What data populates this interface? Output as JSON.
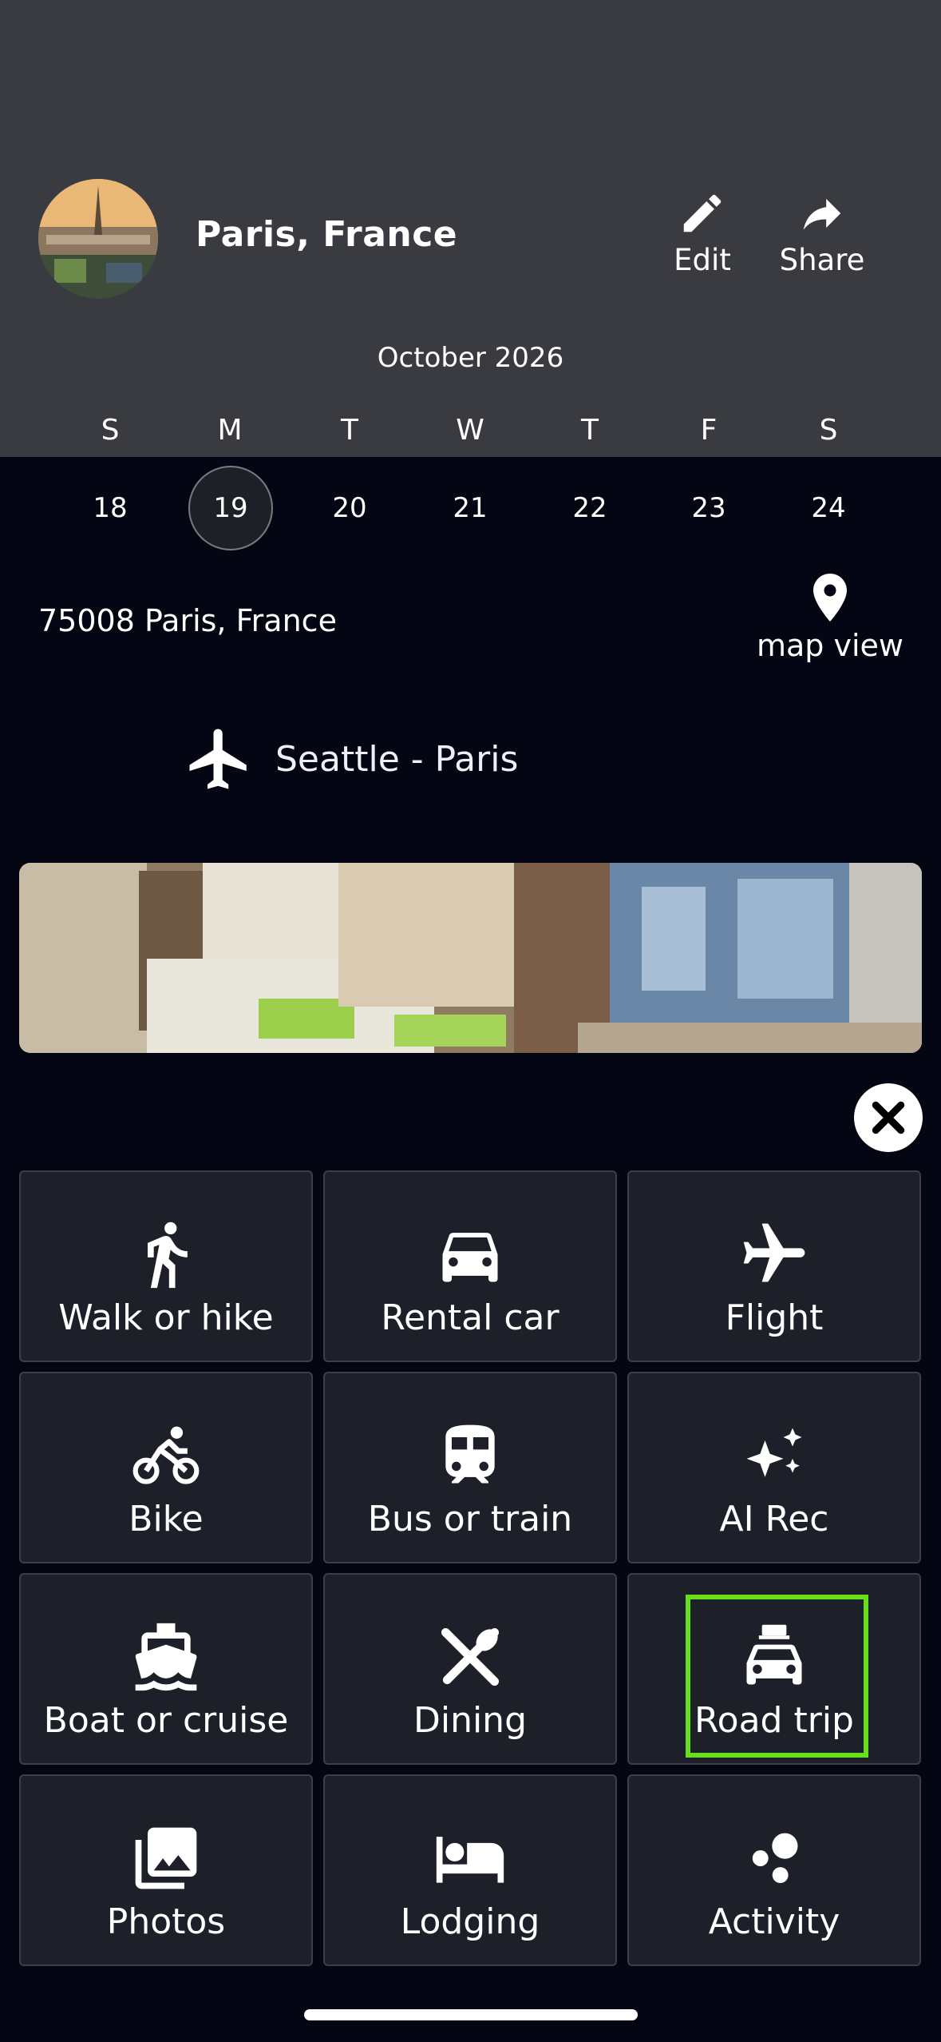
{
  "header": {
    "title": "Paris, France",
    "edit_label": "Edit",
    "share_label": "Share",
    "month": "October 2026"
  },
  "calendar": {
    "days_of_week": [
      "S",
      "M",
      "T",
      "W",
      "T",
      "F",
      "S"
    ],
    "dates": [
      "18",
      "19",
      "20",
      "21",
      "22",
      "23",
      "24"
    ],
    "selected_date": "19"
  },
  "location": {
    "address": "75008 Paris, France",
    "map_view_label": "map view"
  },
  "flight": {
    "route": "Seattle - Paris"
  },
  "add_menu": {
    "items": [
      {
        "label": "Walk or hike",
        "icon": "walk-icon"
      },
      {
        "label": "Rental car",
        "icon": "car-icon"
      },
      {
        "label": "Flight",
        "icon": "airplane-icon"
      },
      {
        "label": "Bike",
        "icon": "bike-icon"
      },
      {
        "label": "Bus or train",
        "icon": "train-icon"
      },
      {
        "label": "AI Rec",
        "icon": "sparkles-icon"
      },
      {
        "label": "Boat or cruise",
        "icon": "boat-icon"
      },
      {
        "label": "Dining",
        "icon": "dining-icon"
      },
      {
        "label": "Road trip",
        "icon": "road-trip-icon"
      },
      {
        "label": "Photos",
        "icon": "photos-icon"
      },
      {
        "label": "Lodging",
        "icon": "bed-icon"
      },
      {
        "label": "Activity",
        "icon": "activity-icon"
      }
    ],
    "highlighted_item": "Road trip",
    "highlight_color": "#66e01a"
  },
  "colors": {
    "header_bg": "#3a3b40",
    "page_bg": "#040713",
    "tile_bg": "#1d2028"
  }
}
